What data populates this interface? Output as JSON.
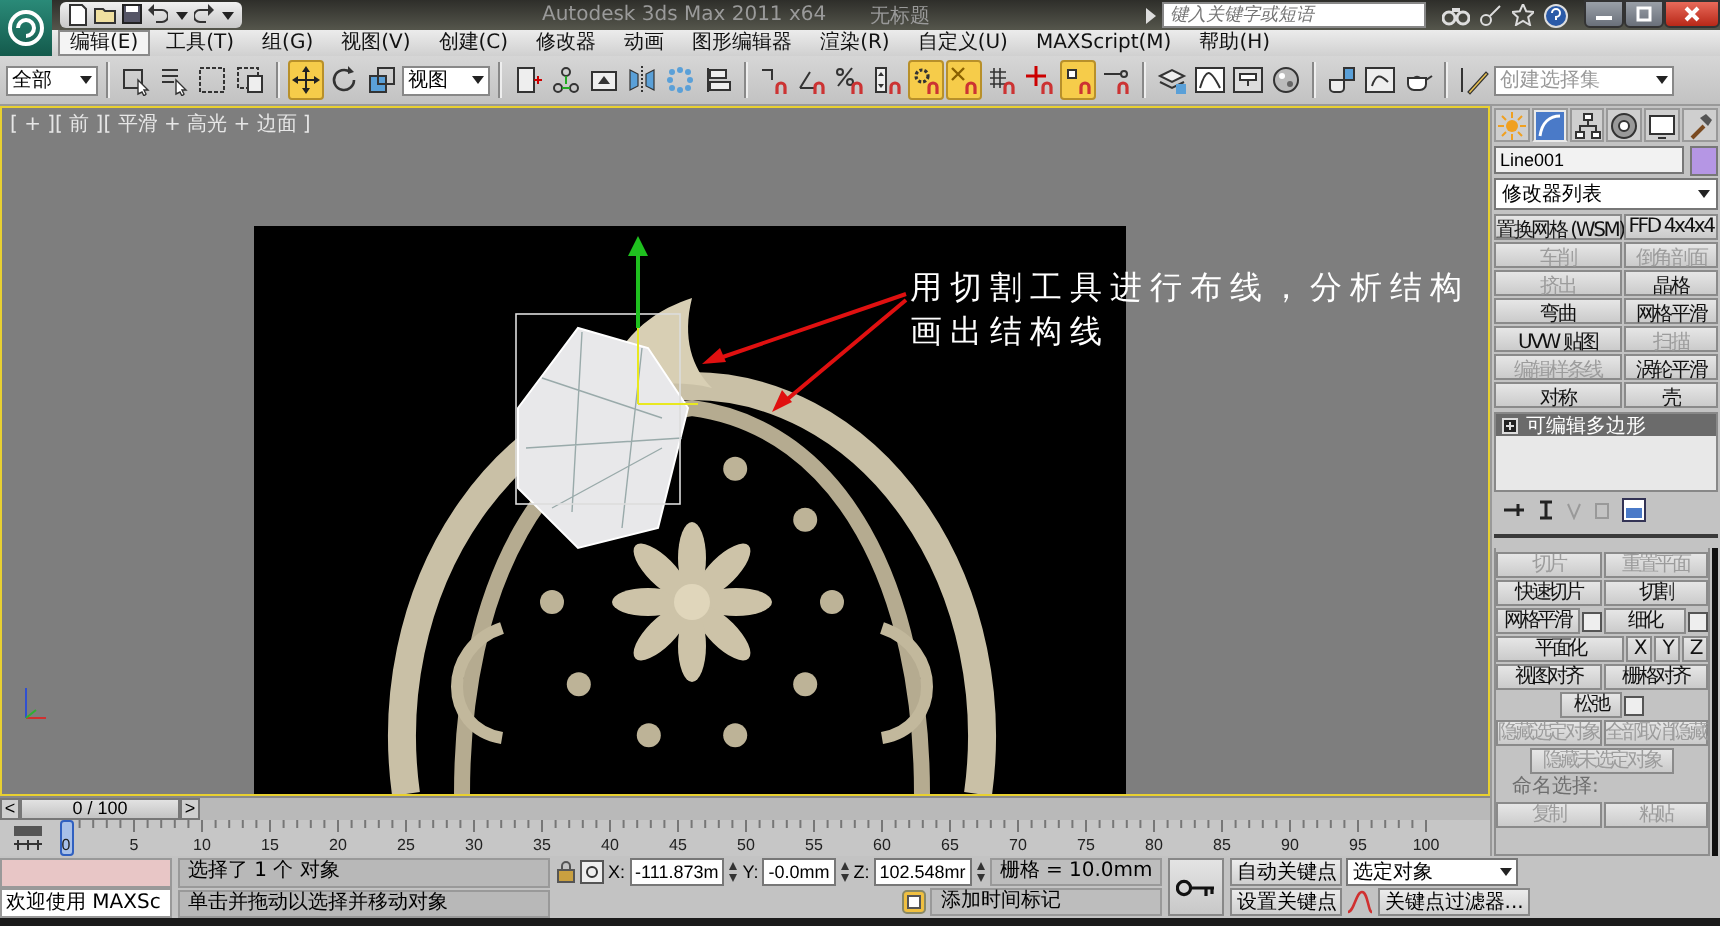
{
  "title_bar": {
    "title": "Autodesk 3ds Max  2011 x64",
    "document": "无标题",
    "search": {
      "placeholder": "键入关键字或短语"
    }
  },
  "menu": [
    {
      "label": "编辑(E)",
      "selected": true
    },
    {
      "label": "工具(T)",
      "selected": false
    },
    {
      "label": "组(G)",
      "selected": false
    },
    {
      "label": "视图(V)",
      "selected": false
    },
    {
      "label": "创建(C)",
      "selected": false
    },
    {
      "label": "修改器",
      "selected": false
    },
    {
      "label": "动画",
      "selected": false
    },
    {
      "label": "图形编辑器",
      "selected": false
    },
    {
      "label": "渲染(R)",
      "selected": false
    },
    {
      "label": "自定义(U)",
      "selected": false
    },
    {
      "label": "MAXScript(M)",
      "selected": false
    },
    {
      "label": "帮助(H)",
      "selected": false
    }
  ],
  "toolbar": {
    "selection_filter": "全部",
    "reference_coordinate": "视图",
    "named_selection_set": {
      "placeholder": "创建选择集"
    },
    "tools": [
      {
        "selected": false
      },
      {
        "selected": false
      },
      {
        "selected": false
      },
      {
        "selected": false
      },
      {
        "selected": true
      },
      {
        "selected": false
      },
      {
        "selected": false
      },
      {
        "selected": false
      },
      {
        "selected": false
      },
      {
        "selected": false
      },
      {
        "selected": false
      },
      {
        "selected": false
      },
      {
        "selected": false
      },
      {
        "selected": false
      },
      {
        "selected": false
      },
      {
        "selected": false
      },
      {
        "selected": false
      },
      {
        "selected": true
      },
      {
        "selected": true
      },
      {
        "selected": false
      },
      {
        "selected": false
      },
      {
        "selected": true
      },
      {
        "selected": false
      },
      {
        "selected": false
      },
      {
        "selected": false
      },
      {
        "selected": false
      },
      {
        "selected": false
      },
      {
        "selected": false
      },
      {
        "selected": false
      },
      {
        "selected": false
      },
      {
        "selected": false
      }
    ]
  },
  "viewport": {
    "label": "[ + ][ 前 ][ 平滑 + 高光 + 边面 ]",
    "annotation": "用切割工具进行布线，分析结构画出结构线"
  },
  "command_panel": {
    "tabs": [
      {
        "selected": false
      },
      {
        "selected": true
      },
      {
        "selected": false
      },
      {
        "selected": false
      },
      {
        "selected": false
      },
      {
        "selected": false
      }
    ],
    "object_name": "Line001",
    "modifier_list": "修改器列表",
    "modifiers": [
      {
        "label": "置换网格 (WSM)",
        "disabled": false
      },
      {
        "label": "FFD 4x4x4",
        "disabled": false
      },
      {
        "label": "车削",
        "disabled": true
      },
      {
        "label": "倒角剖面",
        "disabled": true
      },
      {
        "label": "挤出",
        "disabled": true
      },
      {
        "label": "晶格",
        "disabled": false
      },
      {
        "label": "弯曲",
        "disabled": false
      },
      {
        "label": "网格平滑",
        "disabled": false
      },
      {
        "label": "UVW 贴图",
        "disabled": false
      },
      {
        "label": "扫描",
        "disabled": true
      },
      {
        "label": "编辑样条线",
        "disabled": true
      },
      {
        "label": "涡轮平滑",
        "disabled": false
      },
      {
        "label": "对称",
        "disabled": false
      },
      {
        "label": "壳",
        "disabled": false
      }
    ],
    "stack": [
      {
        "label": "可编辑多边形",
        "selected": true
      }
    ],
    "rollout": [
      {
        "kind": "buttons",
        "buttons": [
          {
            "label": "切片",
            "disabled": true,
            "settings": false
          },
          {
            "label": "重置平面",
            "disabled": true,
            "settings": false
          }
        ]
      },
      {
        "kind": "buttons",
        "buttons": [
          {
            "label": "快速切片",
            "disabled": false,
            "settings": false
          },
          {
            "label": "切割",
            "disabled": false,
            "settings": false
          }
        ]
      },
      {
        "kind": "buttons",
        "buttons": [
          {
            "label": "网格平滑",
            "disabled": false,
            "settings": true
          },
          {
            "label": "细化",
            "disabled": false,
            "settings": true
          }
        ]
      },
      {
        "kind": "buttons",
        "buttons": [
          {
            "label": "平面化",
            "disabled": false,
            "settings": false
          },
          {
            "label": "X",
            "disabled": false,
            "settings": false
          },
          {
            "label": "Y",
            "disabled": false,
            "settings": false
          },
          {
            "label": "Z",
            "disabled": false,
            "settings": false
          }
        ]
      },
      {
        "kind": "buttons",
        "buttons": [
          {
            "label": "视图对齐",
            "disabled": false,
            "settings": false
          },
          {
            "label": "栅格对齐",
            "disabled": false,
            "settings": false
          }
        ]
      },
      {
        "kind": "buttons",
        "buttons": [
          {
            "label": "松弛",
            "disabled": false,
            "settings": true
          }
        ]
      },
      {
        "kind": "buttons",
        "buttons": [
          {
            "label": "隐藏选定对象",
            "disabled": true,
            "settings": false
          },
          {
            "label": "全部取消隐藏",
            "disabled": true,
            "settings": false
          }
        ]
      },
      {
        "kind": "buttons",
        "buttons": [
          {
            "label": "隐藏未选定对象",
            "disabled": true,
            "settings": false
          }
        ]
      },
      {
        "kind": "label",
        "text": "命名选择:",
        "disabled": true
      },
      {
        "kind": "buttons",
        "buttons": [
          {
            "label": "复制",
            "disabled": true,
            "settings": false
          },
          {
            "label": "粘贴",
            "disabled": true,
            "settings": false
          }
        ]
      }
    ]
  },
  "time_slider": {
    "prev": "<",
    "label": "0 / 100",
    "next": ">",
    "level": 0
  },
  "track_bar": {
    "labels": [
      "0",
      "5",
      "10",
      "15",
      "20",
      "25",
      "30",
      "35",
      "40",
      "45",
      "50",
      "55",
      "60",
      "65",
      "70",
      "75",
      "80",
      "85",
      "90",
      "95",
      "100"
    ]
  },
  "status_bar": {
    "listener": "欢迎使用 MAXSc",
    "message": "选择了 1 个 对象",
    "prompt": "单击并拖动以选择并移动对象",
    "x_label": "X:",
    "x": "-111.873m",
    "y_label": "Y:",
    "y": "-0.0mm",
    "z_label": "Z:",
    "z": "102.548mr",
    "grid": "栅格 = 10.0mm",
    "time_tag": "添加时间标记",
    "auto_key": "自动关键点",
    "key_mode": "选定对象",
    "set_key": "设置关键点",
    "key_filters": "关键点过滤器..."
  }
}
